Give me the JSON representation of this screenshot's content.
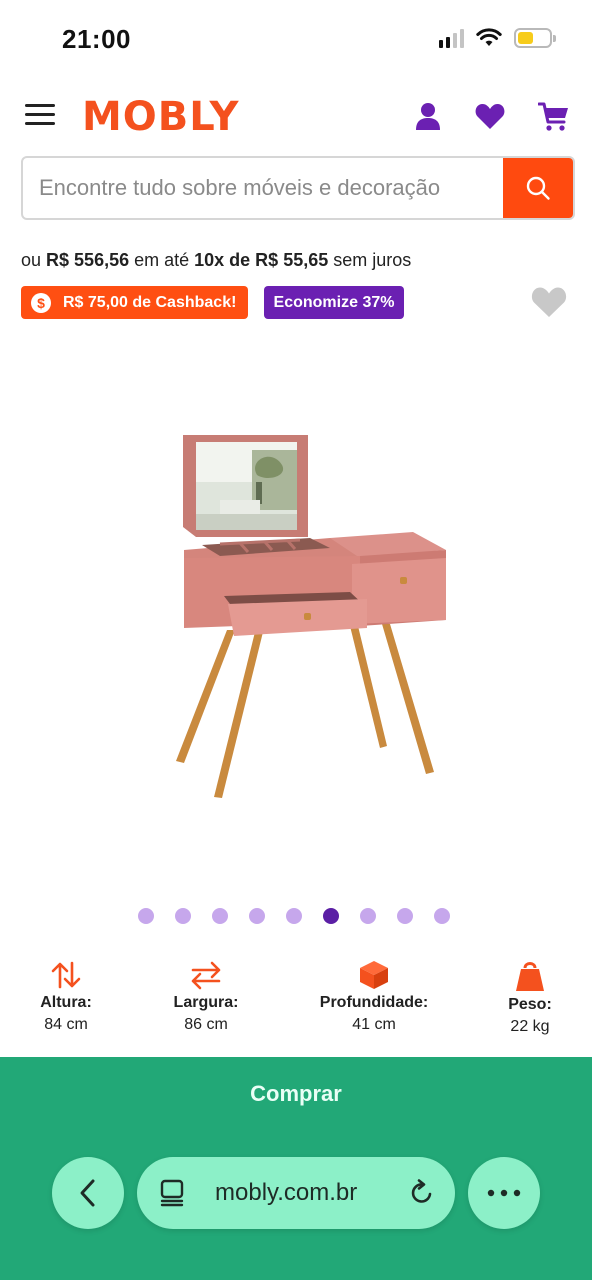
{
  "status_bar": {
    "time": "21:00",
    "battery_color": "#f7cc1b"
  },
  "header": {
    "logo": "MOBLY",
    "brand_color": "#f4511e",
    "accent_color": "#6b20b2",
    "icons": [
      "menu-icon",
      "user-icon",
      "heart-icon",
      "cart-icon"
    ]
  },
  "search": {
    "placeholder": "Encontre tudo sobre móveis e decoração",
    "button_icon": "search-icon"
  },
  "price": {
    "prefix": "ou ",
    "total": "R$ 556,56",
    "middle": " em até ",
    "installments": "10x de R$ 55,65",
    "suffix": " sem juros"
  },
  "badges": {
    "cashback_icon": "$",
    "cashback": "R$ 75,00 de Cashback!",
    "discount": "Economize 37%"
  },
  "carousel": {
    "total": 9,
    "active_index": 5
  },
  "specs": [
    {
      "icon": "height-arrows-icon",
      "label": "Altura:",
      "value": "84 cm"
    },
    {
      "icon": "width-arrows-icon",
      "label": "Largura:",
      "value": "86 cm"
    },
    {
      "icon": "box-icon",
      "label": "Profundidade:",
      "value": "41 cm"
    },
    {
      "icon": "weight-icon",
      "label": "Peso:",
      "value": "22 kg"
    }
  ],
  "buy": {
    "label": "Comprar",
    "color": "#22a877"
  },
  "browser": {
    "url": "mobly.com.br"
  }
}
